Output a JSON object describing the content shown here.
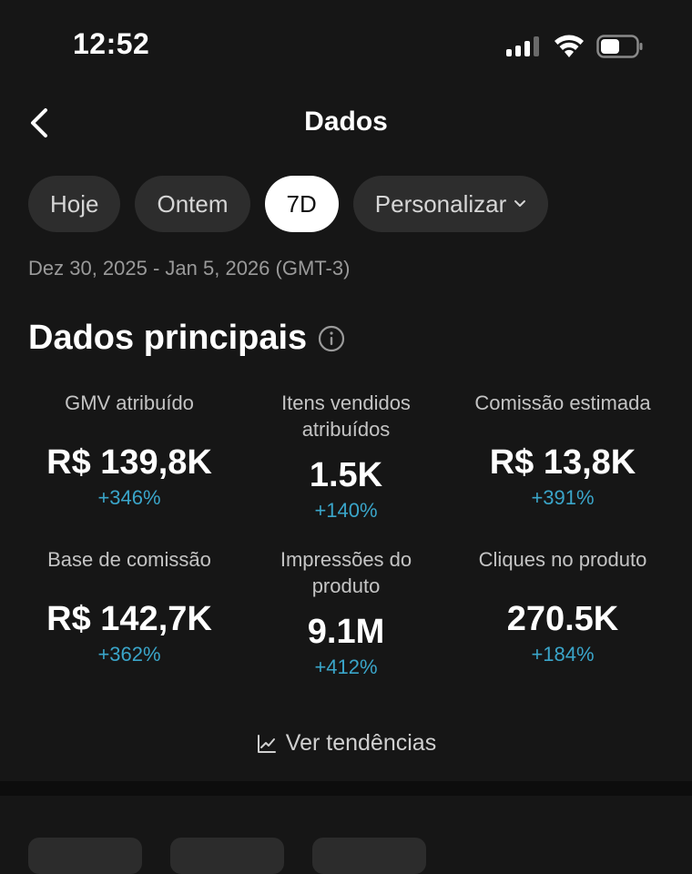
{
  "status_bar": {
    "time": "12:52"
  },
  "header": {
    "title": "Dados"
  },
  "filters": [
    "Hoje",
    "Ontem",
    "7D",
    "Personalizar"
  ],
  "date_range": "Dez 30, 2025 - Jan 5, 2026 (GMT-3)",
  "section": {
    "title": "Dados principais"
  },
  "metrics": [
    {
      "label": "GMV atribuído",
      "value": "R$ 139,8K",
      "delta": "+346%"
    },
    {
      "label": "Itens vendidos atribuídos",
      "value": "1.5K",
      "delta": "+140%"
    },
    {
      "label": "Comissão estimada",
      "value": "R$ 13,8K",
      "delta": "+391%"
    },
    {
      "label": "Base de comissão",
      "value": "R$ 142,7K",
      "delta": "+362%"
    },
    {
      "label": "Impressões do produto",
      "value": "9.1M",
      "delta": "+412%"
    },
    {
      "label": "Cliques no produto",
      "value": "270.5K",
      "delta": "+184%"
    }
  ],
  "trends_link": "Ver tendências",
  "colors": {
    "background": "#161616",
    "chip": "#2d2d2d",
    "active_chip": "#ffffff",
    "delta": "#3aa5c9"
  },
  "icons": [
    "back-chevron-icon",
    "info-icon",
    "trend-chart-icon",
    "chevron-down-icon",
    "signal-icon",
    "wifi-icon",
    "battery-icon"
  ]
}
